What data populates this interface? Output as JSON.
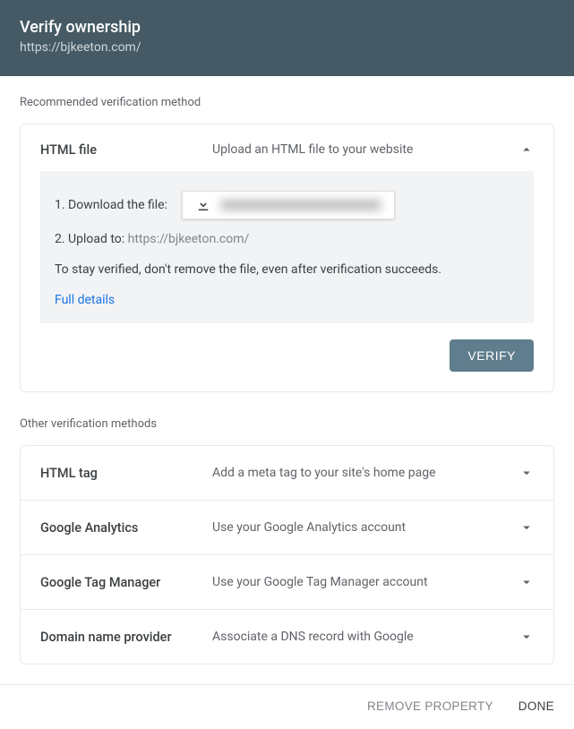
{
  "header": {
    "title": "Verify ownership",
    "subtitle": "https://bjkeeton.com/"
  },
  "recommended_label": "Recommended verification method",
  "html_file": {
    "name": "HTML file",
    "desc": "Upload an HTML file to your website",
    "step1": "1. Download the file:",
    "step2_prefix": "2. Upload to: ",
    "step2_url": "https://bjkeeton.com/",
    "note": "To stay verified, don't remove the file, even after verification succeeds.",
    "details": "Full details",
    "verify": "VERIFY"
  },
  "other_label": "Other verification methods",
  "others": [
    {
      "name": "HTML tag",
      "desc": "Add a meta tag to your site's home page"
    },
    {
      "name": "Google Analytics",
      "desc": "Use your Google Analytics account"
    },
    {
      "name": "Google Tag Manager",
      "desc": "Use your Google Tag Manager account"
    },
    {
      "name": "Domain name provider",
      "desc": "Associate a DNS record with Google"
    }
  ],
  "footer": {
    "remove": "REMOVE PROPERTY",
    "done": "DONE"
  }
}
